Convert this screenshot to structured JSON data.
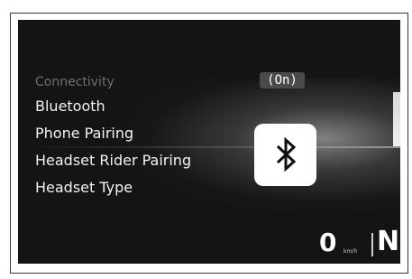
{
  "menu": {
    "title": "Connectivity",
    "items": [
      {
        "label": "Bluetooth"
      },
      {
        "label": "Phone Pairing"
      },
      {
        "label": "Headset Rider Pairing"
      },
      {
        "label": "Headset Type"
      }
    ]
  },
  "status": {
    "value": "(On)"
  },
  "icon": {
    "name": "bluetooth-icon"
  },
  "dashboard": {
    "speed": "0",
    "speed_unit": "km/h",
    "gear": "N"
  },
  "colors": {
    "screen_background": "#141414",
    "text": "#f2f2f2",
    "dim_text": "#6f6f6f",
    "badge": "#4a4a4a"
  }
}
